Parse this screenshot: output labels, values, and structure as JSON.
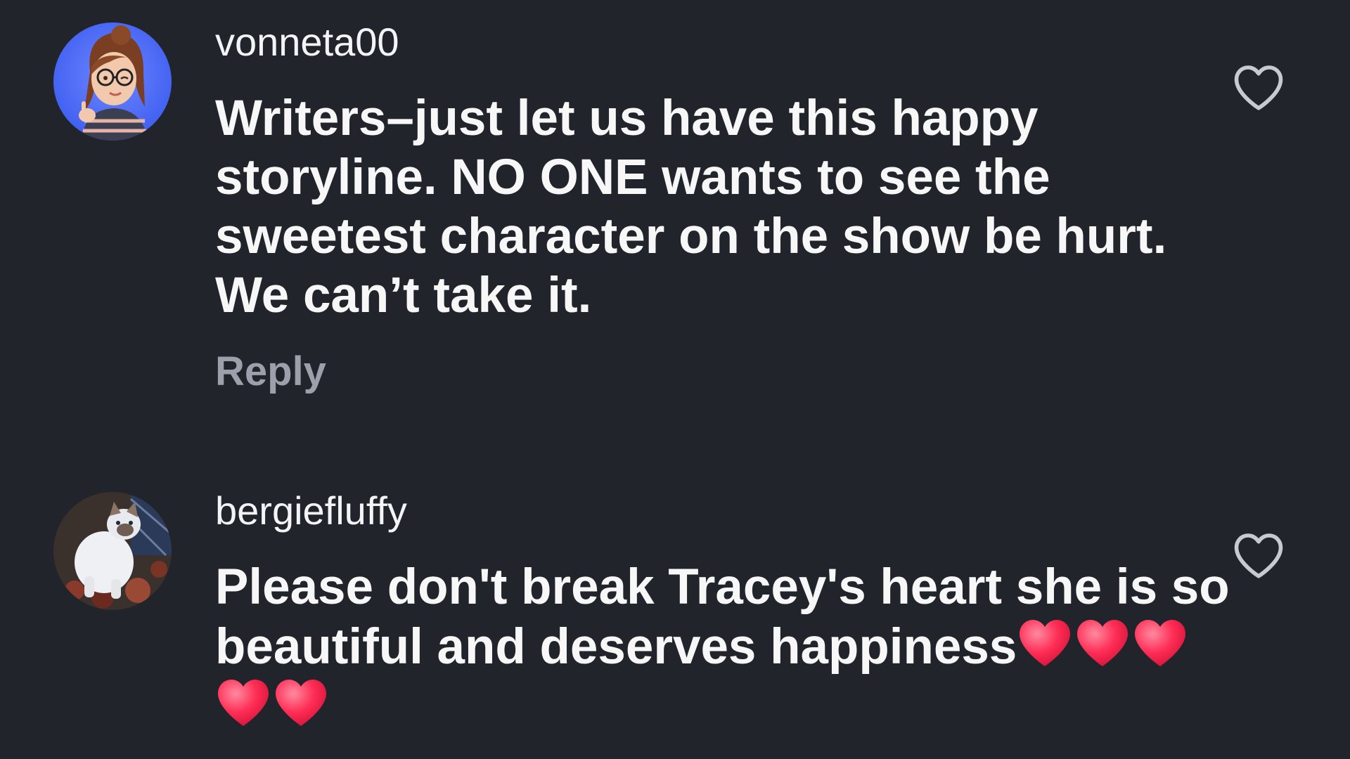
{
  "comments": [
    {
      "username": "vonneta00",
      "text_lines": [
        "Writers–just let us have this happy",
        "storyline.  NO ONE wants to see the",
        "sweetest character on the show be hurt.",
        "We can’t take it."
      ],
      "reply_label": "Reply",
      "avatar_icon": "cartoon-woman-glasses-avatar",
      "like_icon": "heart-outline-icon"
    },
    {
      "username": "bergiefluffy",
      "text_lines": [
        "Please don't break Tracey's heart she is so",
        "beautiful  and deserves happiness"
      ],
      "trailing_emoji": "❤️❤️❤️❤️❤️",
      "avatar_icon": "white-cat-photo-avatar",
      "like_icon": "heart-outline-icon"
    }
  ],
  "colors": {
    "background": "#22242c",
    "text": "#f3f4f6",
    "reply": "#9ca0aa",
    "emoji_heart": "#ff2d55"
  }
}
